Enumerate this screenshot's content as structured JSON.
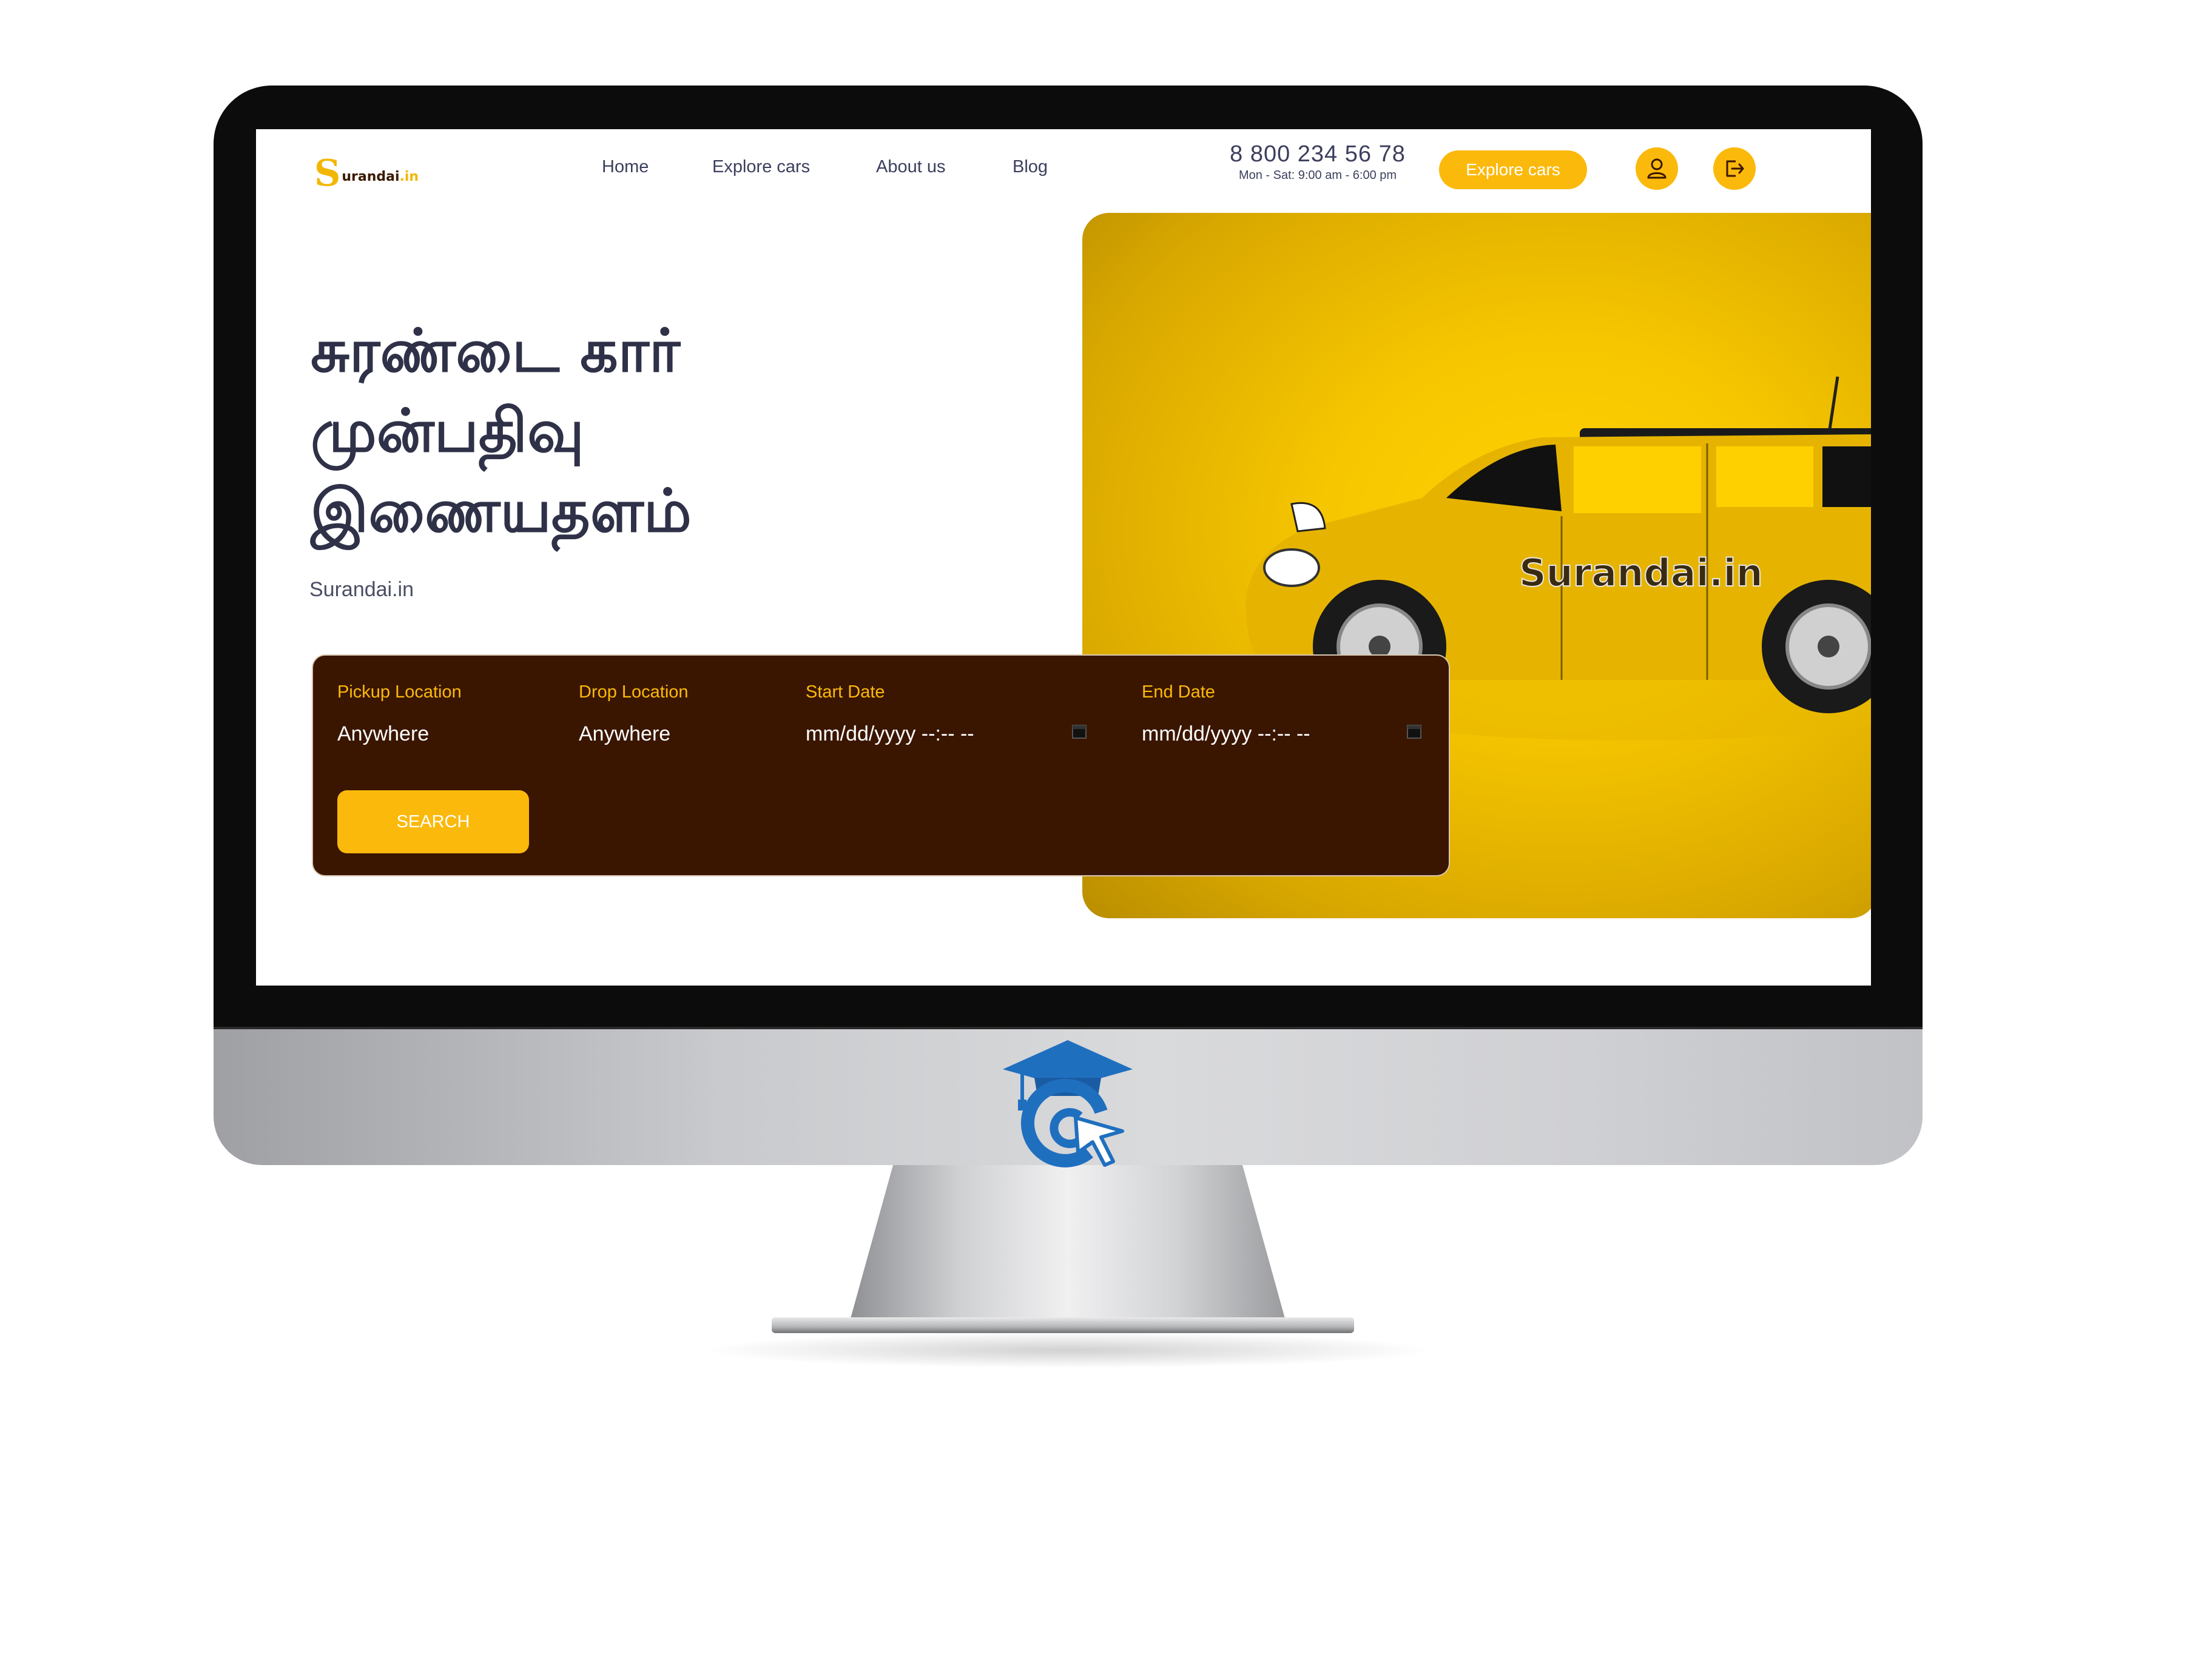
{
  "site": {
    "logo_letter": "S",
    "logo_text": "urandai",
    "logo_suffix": ".in"
  },
  "nav": {
    "home": "Home",
    "explore": "Explore cars",
    "about": "About us",
    "blog": "Blog"
  },
  "contact": {
    "phone": "8 800 234 56 78",
    "hours": "Mon - Sat: 9:00 am - 6:00 pm"
  },
  "header": {
    "explore_button": "Explore cars",
    "user_icon": "user-icon",
    "logout_icon": "logout-icon"
  },
  "hero": {
    "title_line1": "சுரண்டை கார்",
    "title_line2": "முன்பதிவு",
    "title_line3": "இணையதளம்",
    "subtitle": "Surandai.in",
    "car_branding": "Surandai.in"
  },
  "search_form": {
    "pickup_label": "Pickup Location",
    "pickup_value": "Anywhere",
    "drop_label": "Drop Location",
    "drop_value": "Anywhere",
    "start_label": "Start Date",
    "start_value": "mm/dd/yyyy --:-- --",
    "end_label": "End Date",
    "end_value": "mm/dd/yyyy --:-- --",
    "search_button": "SEARCH"
  },
  "colors": {
    "accent": "#fbb90b",
    "panel": "#3a1600",
    "text_dark": "#2e3147"
  }
}
